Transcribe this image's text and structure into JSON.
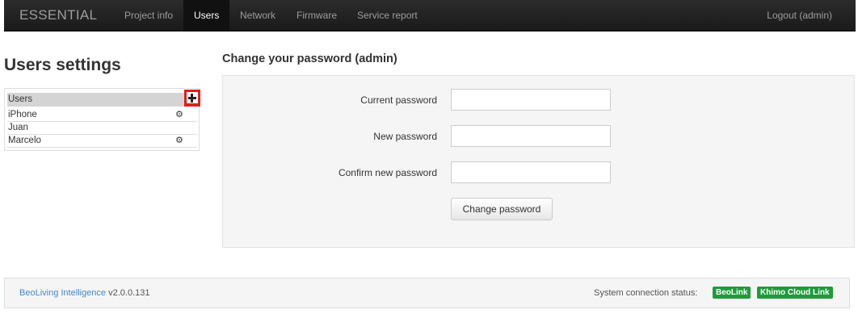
{
  "navbar": {
    "brand": "ESSENTIAL",
    "items": [
      {
        "label": "Project info",
        "active": false
      },
      {
        "label": "Users",
        "active": true
      },
      {
        "label": "Network",
        "active": false
      },
      {
        "label": "Firmware",
        "active": false
      },
      {
        "label": "Service report",
        "active": false
      }
    ],
    "logout": "Logout (admin)"
  },
  "users": {
    "title": "Users settings",
    "header": "Users",
    "add_icon": "plus-icon",
    "list": [
      {
        "name": "iPhone",
        "has_settings": true
      },
      {
        "name": "Juan",
        "has_settings": false
      },
      {
        "name": "Marcelo",
        "has_settings": true
      }
    ],
    "settings_icon": "gear-icon"
  },
  "password": {
    "title": "Change your password (admin)",
    "fields": [
      {
        "label": "Current password",
        "value": ""
      },
      {
        "label": "New password",
        "value": ""
      },
      {
        "label": "Confirm new password",
        "value": ""
      }
    ],
    "submit": "Change password"
  },
  "footer": {
    "product_link": "BeoLiving Intelligence",
    "version": "v2.0.0.131",
    "status_label": "System connection status:",
    "badges": [
      "BeoLink",
      "Khimo Cloud Link"
    ],
    "badge_color": "#1e9b3b"
  }
}
